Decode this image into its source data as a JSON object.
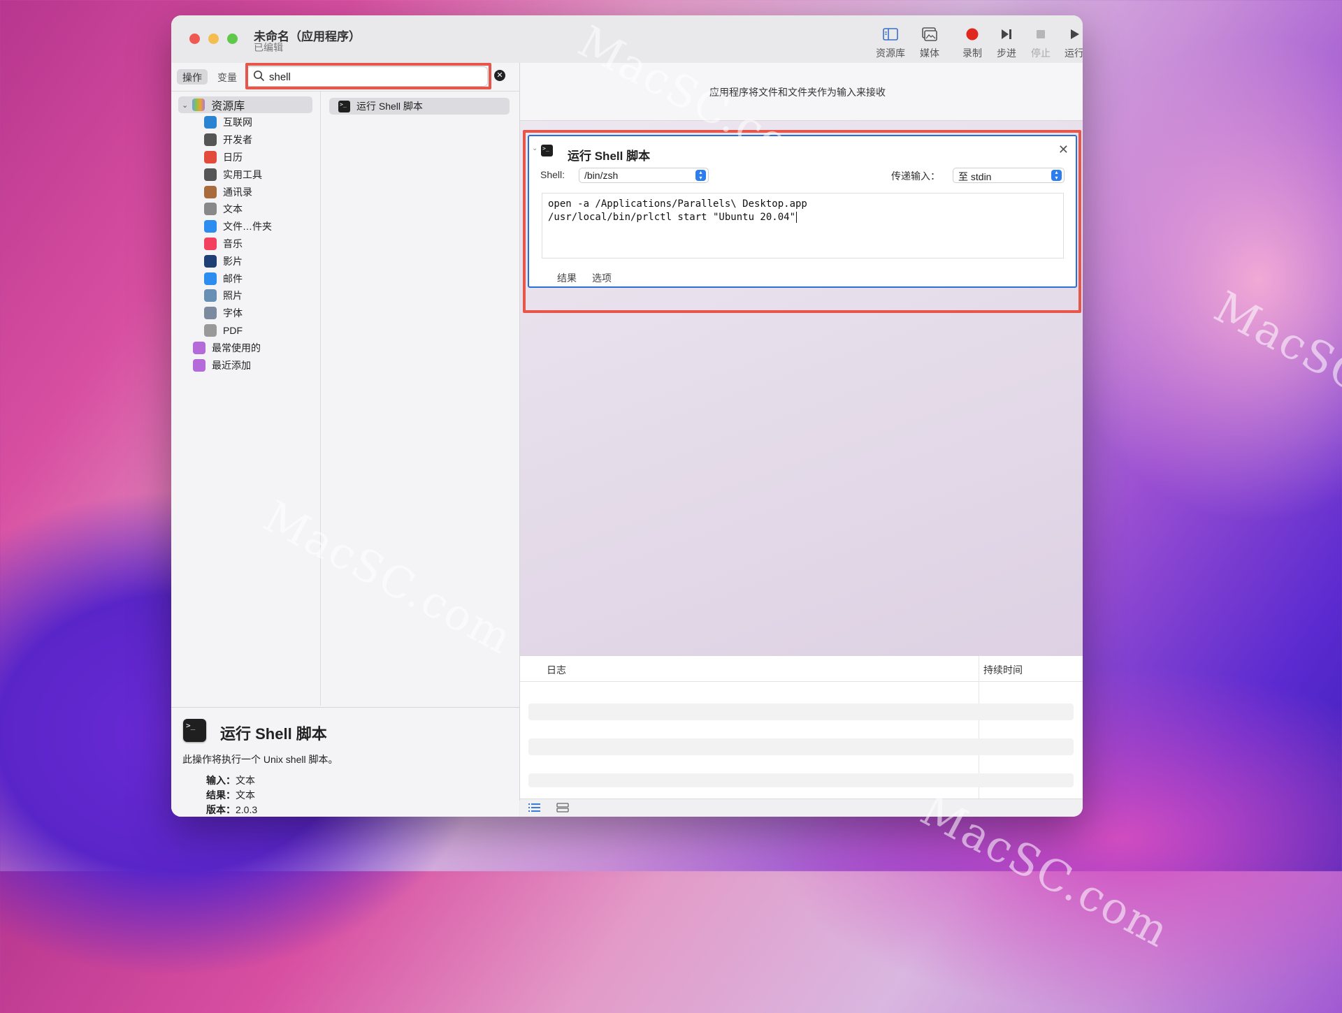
{
  "window": {
    "title": "未命名（应用程序）",
    "subtitle": "已编辑"
  },
  "toolbar": {
    "items": [
      {
        "label": "资源库",
        "icon": "library-icon",
        "enabled": true
      },
      {
        "label": "媒体",
        "icon": "media-icon",
        "enabled": true
      },
      {
        "label": "录制",
        "icon": "record-icon",
        "enabled": true
      },
      {
        "label": "步进",
        "icon": "step-icon",
        "enabled": true
      },
      {
        "label": "停止",
        "icon": "stop-icon",
        "enabled": false
      },
      {
        "label": "运行",
        "icon": "run-icon",
        "enabled": true
      }
    ]
  },
  "sidebar": {
    "tabs": [
      "操作",
      "变量"
    ],
    "search": {
      "value": "shell",
      "placeholder": ""
    },
    "library_root": "资源库",
    "items": [
      {
        "label": "互联网",
        "icon": "globe-icon",
        "color": "#2a84d2"
      },
      {
        "label": "开发者",
        "icon": "tools-icon",
        "color": "#555555"
      },
      {
        "label": "日历",
        "icon": "calendar-icon",
        "color": "#e24a3b"
      },
      {
        "label": "实用工具",
        "icon": "utilities-icon",
        "color": "#555555"
      },
      {
        "label": "通讯录",
        "icon": "contacts-icon",
        "color": "#a86b3d"
      },
      {
        "label": "文本",
        "icon": "text-icon",
        "color": "#888888"
      },
      {
        "label": "文件…件夹",
        "icon": "finder-icon",
        "color": "#2d8cf0"
      },
      {
        "label": "音乐",
        "icon": "music-icon",
        "color": "#f2405e"
      },
      {
        "label": "影片",
        "icon": "movie-icon",
        "color": "#1e3f75"
      },
      {
        "label": "邮件",
        "icon": "mail-icon",
        "color": "#2d8cf0"
      },
      {
        "label": "照片",
        "icon": "photos-icon",
        "color": "#6a8fb5"
      },
      {
        "label": "字体",
        "icon": "font-icon",
        "color": "#7c8aa0"
      },
      {
        "label": "PDF",
        "icon": "pdf-icon",
        "color": "#999999"
      }
    ],
    "smart": [
      {
        "label": "最常使用的",
        "icon": "smart-folder-icon"
      },
      {
        "label": "最近添加",
        "icon": "smart-folder-icon"
      }
    ],
    "result": "运行 Shell 脚本"
  },
  "description": {
    "title": "运行 Shell 脚本",
    "text": "此操作将执行一个 Unix shell 脚本。",
    "input_label": "输入：",
    "input_value": "文本",
    "result_label": "结果：",
    "result_value": "文本",
    "version_label": "版本：",
    "version_value": "2.0.3"
  },
  "workflow": {
    "header": "应用程序将文件和文件夹作为输入来接收",
    "action": {
      "title": "运行 Shell 脚本",
      "shell_label": "Shell:",
      "shell_value": "/bin/zsh",
      "pass_label": "传递输入：",
      "pass_value": "至 stdin",
      "code_line1": "open -a /Applications/Parallels\\ Desktop.app",
      "code_line2": "/usr/local/bin/prlctl start \"Ubuntu 20.04\"",
      "tab_results": "结果",
      "tab_options": "选项"
    }
  },
  "log": {
    "col_log": "日志",
    "col_duration": "持续时间"
  },
  "watermark": "MacSC.com",
  "colors": {
    "highlight": "#e6564b",
    "selection": "#2a6fd6",
    "record": "#e0281e"
  }
}
